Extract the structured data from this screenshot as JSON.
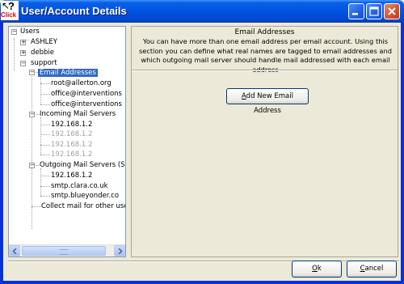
{
  "window": {
    "title": "User/Account Details",
    "help_icon_text": "Click",
    "controls": [
      "help-cursor-icon",
      "minimize-icon",
      "maximize-icon",
      "close-icon"
    ]
  },
  "tree": {
    "items": [
      {
        "label": "Users",
        "state": "normal"
      },
      {
        "label": "ASHLEY",
        "state": "normal"
      },
      {
        "label": "debbie",
        "state": "normal"
      },
      {
        "label": "support",
        "state": "normal"
      },
      {
        "label": "Email Addresses",
        "state": "selected"
      },
      {
        "label": "root@allerton.org",
        "state": "normal"
      },
      {
        "label": "office@interventions",
        "state": "normal"
      },
      {
        "label": "office@interventions",
        "state": "normal"
      },
      {
        "label": "Incoming Mail Servers",
        "state": "normal"
      },
      {
        "label": "192.168.1.2",
        "state": "normal"
      },
      {
        "label": "192.168.1.2",
        "state": "grey"
      },
      {
        "label": "192.168.1.2",
        "state": "grey"
      },
      {
        "label": "192.168.1.2",
        "state": "grey"
      },
      {
        "label": "Outgoing Mail Servers (S",
        "state": "normal"
      },
      {
        "label": "192.168.1.2",
        "state": "normal"
      },
      {
        "label": "smtp.clara.co.uk",
        "state": "normal"
      },
      {
        "label": "smtp.blueyonder.co",
        "state": "normal"
      },
      {
        "label": "Collect mail for other use",
        "state": "normal"
      }
    ]
  },
  "panel": {
    "title": "Email Addresses",
    "description": "You can have more than one email address per email account.  Using this section you can define what real names are tagged to email addresses and which outgoing mail server should handle mail addressed with each email  address",
    "add_button": {
      "mnemonic": "A",
      "rest": "dd New Email Address"
    }
  },
  "footer": {
    "ok_button": {
      "mnemonic": "O",
      "rest": "k"
    },
    "cancel_button": {
      "mnemonic": "C",
      "rest": "ancel"
    }
  },
  "colors": {
    "titlebar": "#0054e3",
    "selection": "#316ac5",
    "window_bg": "#ece9d8"
  }
}
